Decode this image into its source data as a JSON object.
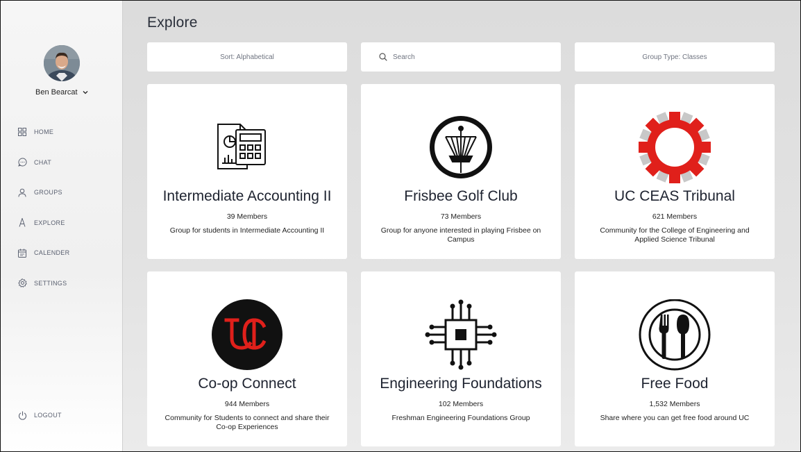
{
  "sidebar": {
    "user_name": "Ben Bearcat",
    "nav": [
      {
        "label": "HOME",
        "icon": "grid-icon"
      },
      {
        "label": "CHAT",
        "icon": "chat-icon"
      },
      {
        "label": "GROUPS",
        "icon": "person-icon"
      },
      {
        "label": "EXPLORE",
        "icon": "explore-icon"
      },
      {
        "label": "CALENDER",
        "icon": "calendar-icon"
      },
      {
        "label": "SETTINGS",
        "icon": "gear-icon"
      }
    ],
    "logout_label": "LOGOUT"
  },
  "page": {
    "title": "Explore",
    "sort_label": "Sort: Alphabetical",
    "search_placeholder": "Search",
    "group_type_label": "Group Type: Classes"
  },
  "groups": [
    {
      "name": "Intermediate Accounting II",
      "members": "39 Members",
      "description": "Group for students in Intermediate Accounting II",
      "icon": "accounting-icon"
    },
    {
      "name": "Frisbee Golf Club",
      "members": "73 Members",
      "description": "Group for anyone interested in playing Frisbee on Campus",
      "icon": "disc-golf-basket-icon"
    },
    {
      "name": "UC CEAS Tribunal",
      "members": "621 Members",
      "description": "Community for the College of Engineering and Applied Science Tribunal",
      "icon": "gear-logo-icon"
    },
    {
      "name": "Co-op Connect",
      "members": "944 Members",
      "description": "Community for Students to connect and share their Co-op Experiences",
      "icon": "uc-logo-icon"
    },
    {
      "name": "Engineering Foundations",
      "members": "102 Members",
      "description": "Freshman Engineering Foundations Group",
      "icon": "circuit-chip-icon"
    },
    {
      "name": "Free Food",
      "members": "1,532 Members",
      "description": "Share where you can get free food around UC",
      "icon": "fork-spoon-icon"
    }
  ],
  "colors": {
    "accent_red": "#e0201b",
    "nav_text": "#5a6070"
  }
}
